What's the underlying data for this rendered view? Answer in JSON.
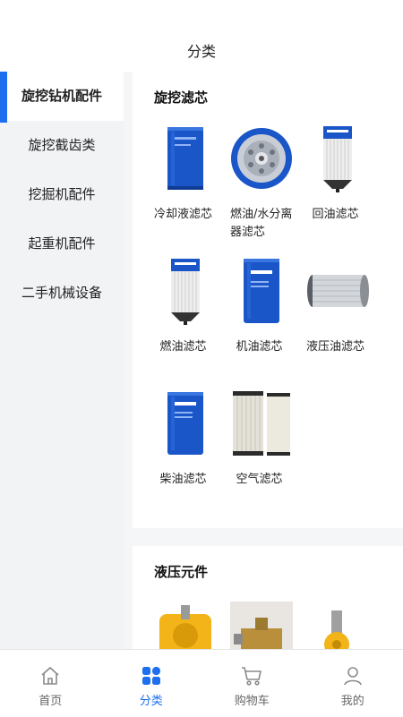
{
  "header": {
    "title": "分类"
  },
  "sidebar": {
    "items": [
      {
        "label": "旋挖钻机配件",
        "active": true
      },
      {
        "label": "旋挖截齿类",
        "active": false
      },
      {
        "label": "挖掘机配件",
        "active": false
      },
      {
        "label": "起重机配件",
        "active": false
      },
      {
        "label": "二手机械设备",
        "active": false
      }
    ]
  },
  "sections": [
    {
      "title": "旋挖滤芯",
      "products": [
        {
          "name": "冷却液滤芯",
          "image": "blue-canister-filter"
        },
        {
          "name": "燃油/水分离器滤芯",
          "image": "spin-on-filter-top"
        },
        {
          "name": "回油滤芯",
          "image": "white-element-filter-xcmg"
        },
        {
          "name": "燃油滤芯",
          "image": "white-element-filter-xcmg"
        },
        {
          "name": "机油滤芯",
          "image": "blue-canister-filter-xcmg"
        },
        {
          "name": "液压油滤芯",
          "image": "horizontal-mesh-element"
        },
        {
          "name": "柴油滤芯",
          "image": "blue-canister-filter-xcmg"
        },
        {
          "name": "空气滤芯",
          "image": "air-filter-pair"
        }
      ]
    },
    {
      "title": "液压元件",
      "products": [
        {
          "name": "",
          "image": "yellow-hydraulic-motor"
        },
        {
          "name": "",
          "image": "brass-valve-fitting"
        },
        {
          "name": "",
          "image": "yellow-cylinder-end"
        }
      ]
    }
  ],
  "tabbar": {
    "items": [
      {
        "label": "首页",
        "icon": "home-icon",
        "active": false
      },
      {
        "label": "分类",
        "icon": "category-icon",
        "active": true
      },
      {
        "label": "购物车",
        "icon": "cart-icon",
        "active": false
      },
      {
        "label": "我的",
        "icon": "profile-icon",
        "active": false
      }
    ]
  },
  "colors": {
    "accent": "#1e6ff0",
    "filter_blue": "#1a56c8"
  }
}
